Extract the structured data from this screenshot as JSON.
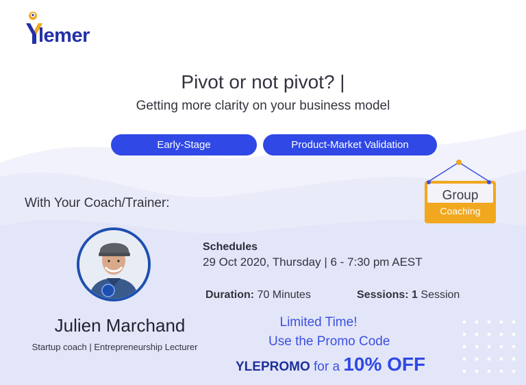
{
  "brand": {
    "name": "lemer",
    "logo_letter": "Y"
  },
  "title": "Pivot or not pivot? |",
  "subtitle": "Getting more clarity on your business model",
  "tags": [
    "Early-Stage",
    "Product-Market Validation"
  ],
  "coach_heading": "With Your Coach/Trainer:",
  "coach": {
    "name": "Julien Marchand",
    "role": "Startup coach | Entrepreneurship Lecturer"
  },
  "schedule": {
    "label": "Schedules",
    "value": "29 Oct 2020, Thursday | 6 - 7:30 pm AEST"
  },
  "duration": {
    "label": "Duration:",
    "value": "70 Minutes"
  },
  "sessions": {
    "label": "Sessions:",
    "count": "1",
    "unit": "Session"
  },
  "promo": {
    "line1": "Limited Time!",
    "line2": "Use the Promo Code",
    "code": "YLEPROMO",
    "for_a": "for a",
    "discount": "10% OFF"
  },
  "badge": {
    "title": "Group",
    "subtitle": "Coaching"
  },
  "colors": {
    "primary": "#2f48e6",
    "brand_navy": "#2430a8",
    "accent_orange": "#f0a81e",
    "wave": "#e9ebf9"
  },
  "icons": [
    "logo-mascot-icon",
    "hanging-sign-icon",
    "dots-pattern-icon",
    "coach-avatar"
  ]
}
